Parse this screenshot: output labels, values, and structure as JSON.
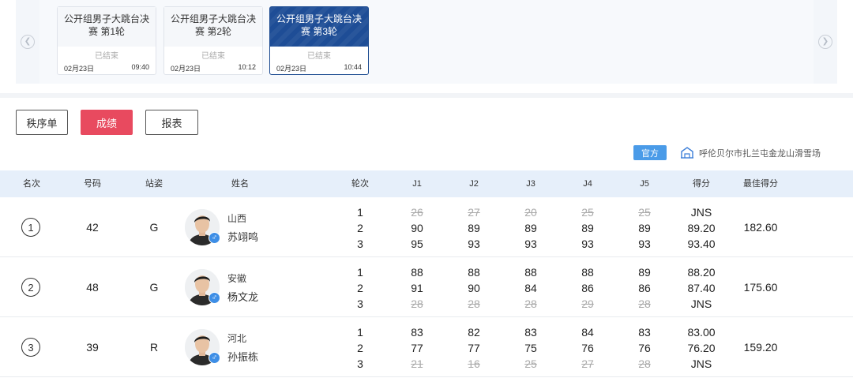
{
  "carousel": {
    "sessions": [
      {
        "title": "公开组男子大跳台决赛 第1轮",
        "status": "已结束",
        "date": "02月23日",
        "time": "09:40",
        "active": false
      },
      {
        "title": "公开组男子大跳台决赛 第2轮",
        "status": "已结束",
        "date": "02月23日",
        "time": "10:12",
        "active": false
      },
      {
        "title": "公开组男子大跳台决赛 第3轮",
        "status": "已结束",
        "date": "02月23日",
        "time": "10:44",
        "active": true
      }
    ]
  },
  "tabs": {
    "start_list": "秩序单",
    "results": "成绩",
    "report": "报表"
  },
  "meta": {
    "official_badge": "官方",
    "venue": "呼伦贝尔市扎兰屯金龙山滑雪场"
  },
  "table": {
    "headers": {
      "rank": "名次",
      "bib": "号码",
      "stance": "站姿",
      "name": "姓名",
      "run": "轮次",
      "j1": "J1",
      "j2": "J2",
      "j3": "J3",
      "j4": "J4",
      "j5": "J5",
      "score": "得分",
      "best": "最佳得分"
    },
    "rows": [
      {
        "rank": "1",
        "bib": "42",
        "stance": "G",
        "province": "山西",
        "name": "苏翊鸣",
        "runs": [
          {
            "run": "1",
            "judges": [
              "26",
              "27",
              "20",
              "25",
              "25"
            ],
            "score": "JNS",
            "struck": true
          },
          {
            "run": "2",
            "judges": [
              "90",
              "89",
              "89",
              "89",
              "89"
            ],
            "score": "89.20",
            "struck": false
          },
          {
            "run": "3",
            "judges": [
              "95",
              "93",
              "93",
              "93",
              "93"
            ],
            "score": "93.40",
            "struck": false
          }
        ],
        "best": "182.60"
      },
      {
        "rank": "2",
        "bib": "48",
        "stance": "G",
        "province": "安徽",
        "name": "杨文龙",
        "runs": [
          {
            "run": "1",
            "judges": [
              "88",
              "88",
              "88",
              "88",
              "89"
            ],
            "score": "88.20",
            "struck": false
          },
          {
            "run": "2",
            "judges": [
              "91",
              "90",
              "84",
              "86",
              "86"
            ],
            "score": "87.40",
            "struck": false
          },
          {
            "run": "3",
            "judges": [
              "28",
              "28",
              "28",
              "29",
              "28"
            ],
            "score": "JNS",
            "struck": true
          }
        ],
        "best": "175.60"
      },
      {
        "rank": "3",
        "bib": "39",
        "stance": "R",
        "province": "河北",
        "name": "孙振栋",
        "runs": [
          {
            "run": "1",
            "judges": [
              "83",
              "82",
              "83",
              "84",
              "83"
            ],
            "score": "83.00",
            "struck": false
          },
          {
            "run": "2",
            "judges": [
              "77",
              "77",
              "75",
              "76",
              "76"
            ],
            "score": "76.20",
            "struck": false
          },
          {
            "run": "3",
            "judges": [
              "21",
              "16",
              "25",
              "27",
              "28"
            ],
            "score": "JNS",
            "struck": true
          }
        ],
        "best": "159.20"
      }
    ]
  },
  "colors": {
    "accent_red": "#e84a5f",
    "active_card_blue": "#1e4d96",
    "header_band": "#e6effa",
    "badge_blue": "#4a9be8",
    "gender_blue": "#3d8ee6"
  },
  "icons": {
    "prev": "chevron-left-icon",
    "next": "chevron-right-icon",
    "venue": "building-icon",
    "gender": "male-icon"
  }
}
